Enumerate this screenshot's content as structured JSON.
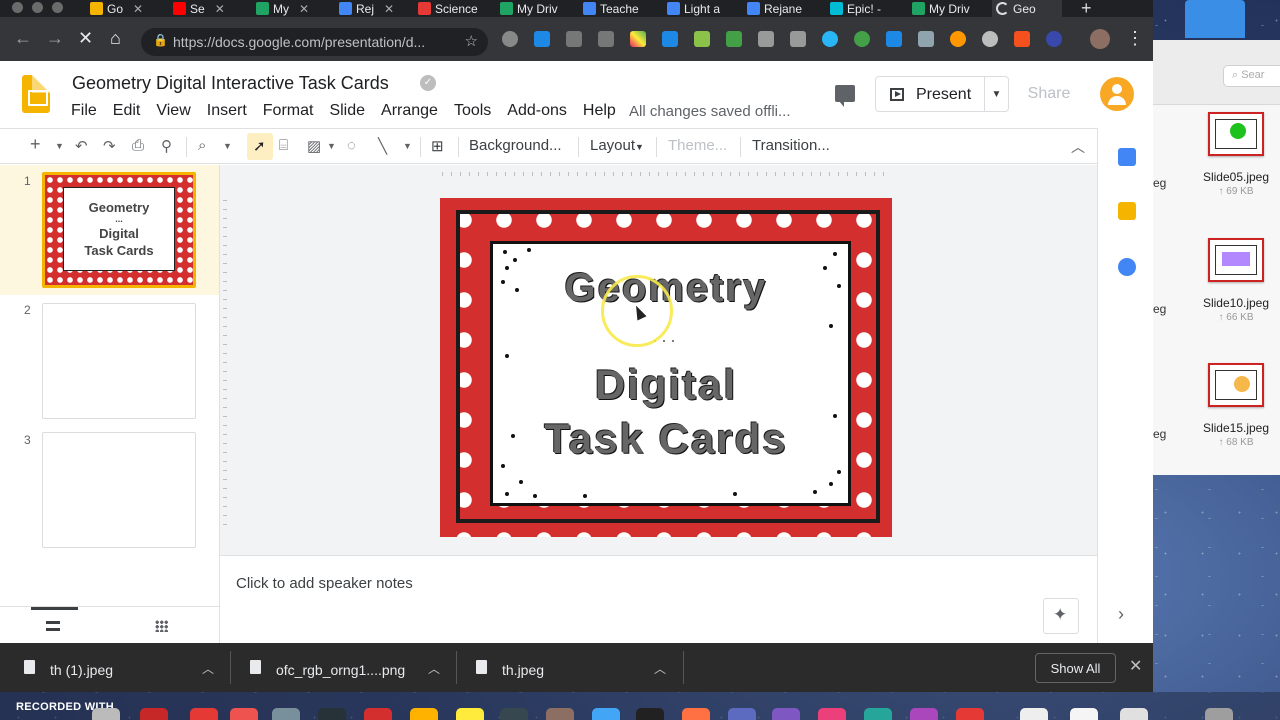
{
  "browser": {
    "tabs": [
      {
        "label": "Go",
        "color": "#f4b400"
      },
      {
        "label": "Se",
        "color": "#ff0000"
      },
      {
        "label": "My",
        "color": "#1fa463"
      },
      {
        "label": "Rej",
        "color": "#4285f4"
      },
      {
        "label": "Science",
        "color": "#e53935"
      },
      {
        "label": "My Driv",
        "color": "#1fa463"
      },
      {
        "label": "Teache",
        "color": "#4285f4"
      },
      {
        "label": "Light a",
        "color": "#4285f4"
      },
      {
        "label": "Rejane",
        "color": "#4285f4"
      },
      {
        "label": "Epic! -",
        "color": "#00bcd4"
      },
      {
        "label": "My Driv",
        "color": "#1fa463"
      },
      {
        "label": "Geo",
        "color": "#f4b400"
      }
    ],
    "new_tab": "+",
    "url": "https://docs.google.com/presentation/d..."
  },
  "app": {
    "title": "Geometry Digital Interactive Task Cards",
    "menu": [
      "File",
      "Edit",
      "View",
      "Insert",
      "Format",
      "Slide",
      "Arrange",
      "Tools",
      "Add-ons",
      "Help"
    ],
    "saved_status": "All changes saved offli...",
    "present_label": "Present",
    "share_label": "Share"
  },
  "toolbar": {
    "background": "Background...",
    "layout": "Layout",
    "theme": "Theme...",
    "transition": "Transition..."
  },
  "filmstrip": {
    "slides": [
      {
        "number": "1",
        "title": "Geometry",
        "dots": "...",
        "subtitle1": "Digital",
        "subtitle2": "Task Cards"
      },
      {
        "number": "2"
      },
      {
        "number": "3"
      }
    ]
  },
  "slide": {
    "title": "Geometry",
    "ellipsis": "...",
    "line2": "Digital",
    "line3": "Task Cards"
  },
  "notes": {
    "placeholder": "Click to add speaker notes"
  },
  "downloads": {
    "items": [
      {
        "name": "th (1).jpeg"
      },
      {
        "name": "ofc_rgb_orng1....png"
      },
      {
        "name": "th.jpeg"
      }
    ],
    "show_all": "Show All"
  },
  "finder": {
    "search_placeholder": "Sear",
    "partial_exts": [
      "eg",
      "eg",
      "eg"
    ],
    "files": [
      {
        "name": "Slide05.jpeg",
        "size": "69 KB"
      },
      {
        "name": "Slide10.jpeg",
        "size": "66 KB"
      },
      {
        "name": "Slide15.jpeg",
        "size": "68 KB"
      }
    ]
  },
  "dock": {
    "recorded_label": "RECORDED WITH"
  }
}
